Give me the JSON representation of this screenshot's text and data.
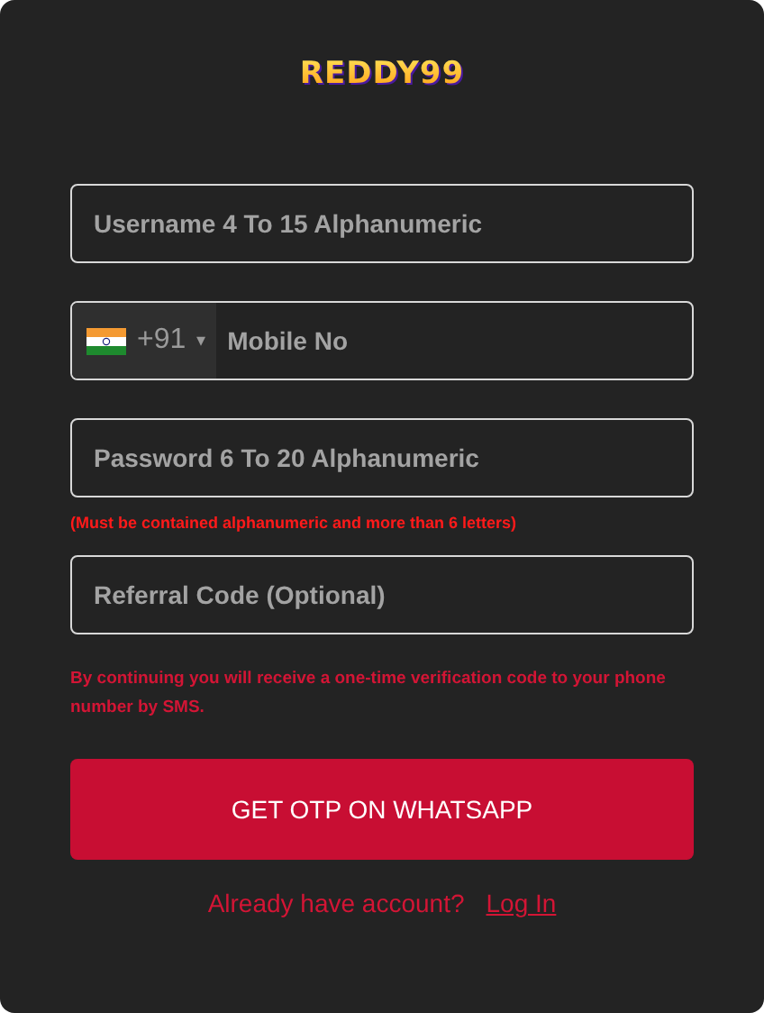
{
  "logo": "REDDY99",
  "fields": [
    {
      "kind": "text",
      "placeholder": "Username 4 To 15 Alphanumeric"
    },
    {
      "kind": "phone",
      "country_code": "+91",
      "caret": "▾",
      "placeholder": "Mobile No"
    },
    {
      "kind": "text",
      "placeholder": "Password 6 To 20 Alphanumeric",
      "hint": "(Must be contained alphanumeric and more than 6 letters)"
    },
    {
      "kind": "text",
      "placeholder": "Referral Code (Optional)"
    }
  ],
  "notice": "By continuing you will receive a one-time verification code to your phone number by SMS.",
  "submit_button": "GET OTP ON WHATSAPP",
  "login_prompt": {
    "text": "Already have account?",
    "link": "Log In"
  }
}
